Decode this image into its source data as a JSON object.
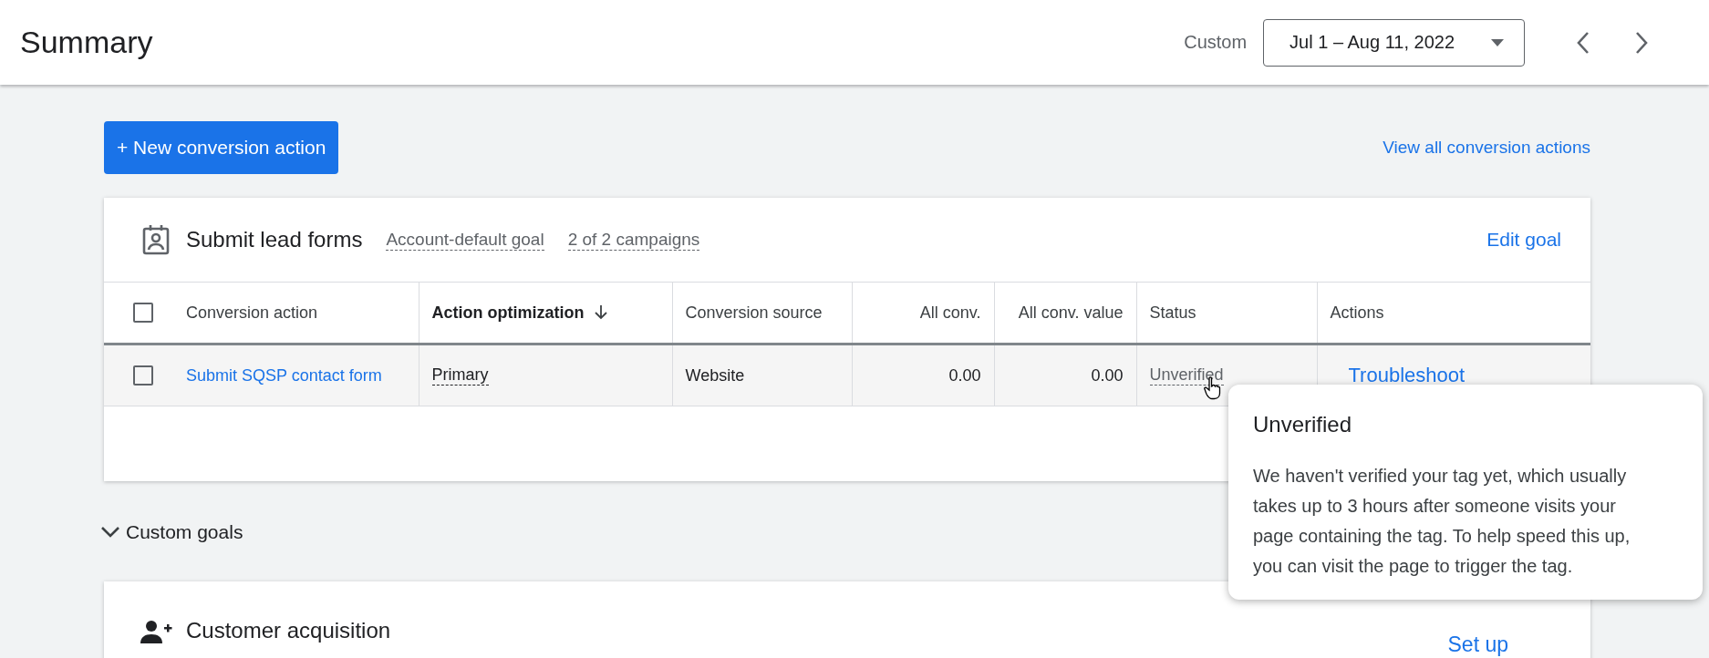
{
  "header": {
    "title": "Summary",
    "range_label": "Custom",
    "date_range": "Jul 1 – Aug 11, 2022"
  },
  "toolbar": {
    "new_button": "+ New conversion action",
    "view_all_link": "View all conversion actions"
  },
  "goal_card": {
    "title": "Submit lead forms",
    "tags": [
      "Account-default goal",
      "2 of 2 campaigns"
    ],
    "edit_link": "Edit goal",
    "table": {
      "select_all": {
        "checked": false
      },
      "columns": [
        {
          "label": "Conversion action",
          "kind": "text",
          "sorted": false
        },
        {
          "label": "Action optimization",
          "kind": "text",
          "sorted": true
        },
        {
          "label": "Conversion source",
          "kind": "text",
          "sorted": false
        },
        {
          "label": "All conv.",
          "kind": "number",
          "sorted": false
        },
        {
          "label": "All conv. value",
          "kind": "number",
          "sorted": false
        },
        {
          "label": "Status",
          "kind": "text",
          "sorted": false
        },
        {
          "label": "Actions",
          "kind": "text",
          "sorted": false
        }
      ],
      "rows": [
        {
          "checked": false,
          "cells": [
            {
              "kind": "link",
              "text": "Submit SQSP contact form"
            },
            {
              "kind": "dotted",
              "text": "Primary"
            },
            {
              "kind": "text",
              "text": "Website"
            },
            {
              "kind": "number",
              "text": "0.00"
            },
            {
              "kind": "number",
              "text": "0.00"
            },
            {
              "kind": "status",
              "text": "Unverified"
            },
            {
              "kind": "action",
              "text": "Troubleshoot"
            }
          ]
        }
      ]
    }
  },
  "custom_goals": {
    "label": "Custom goals"
  },
  "second_card": {
    "title": "Customer acquisition",
    "action": "Set up"
  },
  "tooltip": {
    "title": "Unverified",
    "body": "We haven't verified your tag yet, which usually takes up to 3 hours after someone visits your page containing the tag. To help speed this up, you can visit the page to trigger the tag."
  }
}
